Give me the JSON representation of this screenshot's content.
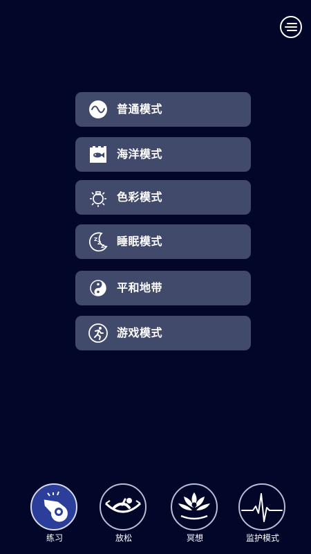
{
  "header": {
    "menu_icon": "list-menu-icon"
  },
  "modes": [
    {
      "label": "普通模式",
      "icon": "wave-circle-icon"
    },
    {
      "label": "海洋模式",
      "icon": "fish-tank-icon"
    },
    {
      "label": "色彩模式",
      "icon": "light-bulb-icon"
    },
    {
      "label": "睡眠模式",
      "icon": "moon-zzz-icon"
    },
    {
      "label": "平和地带",
      "icon": "yin-yang-icon"
    },
    {
      "label": "游戏模式",
      "icon": "running-man-icon"
    }
  ],
  "bottom_nav": [
    {
      "label": "练习",
      "icon": "whistle-icon",
      "active": true
    },
    {
      "label": "放松",
      "icon": "hammock-icon",
      "active": false
    },
    {
      "label": "冥想",
      "icon": "lotus-meditation-icon",
      "active": false
    },
    {
      "label": "监护模式",
      "icon": "heartbeat-monitor-icon",
      "active": false
    }
  ],
  "colors": {
    "background": "#02072a",
    "card": "#424a6c",
    "active_nav": "#2b3f9a",
    "text": "#ffffff"
  }
}
